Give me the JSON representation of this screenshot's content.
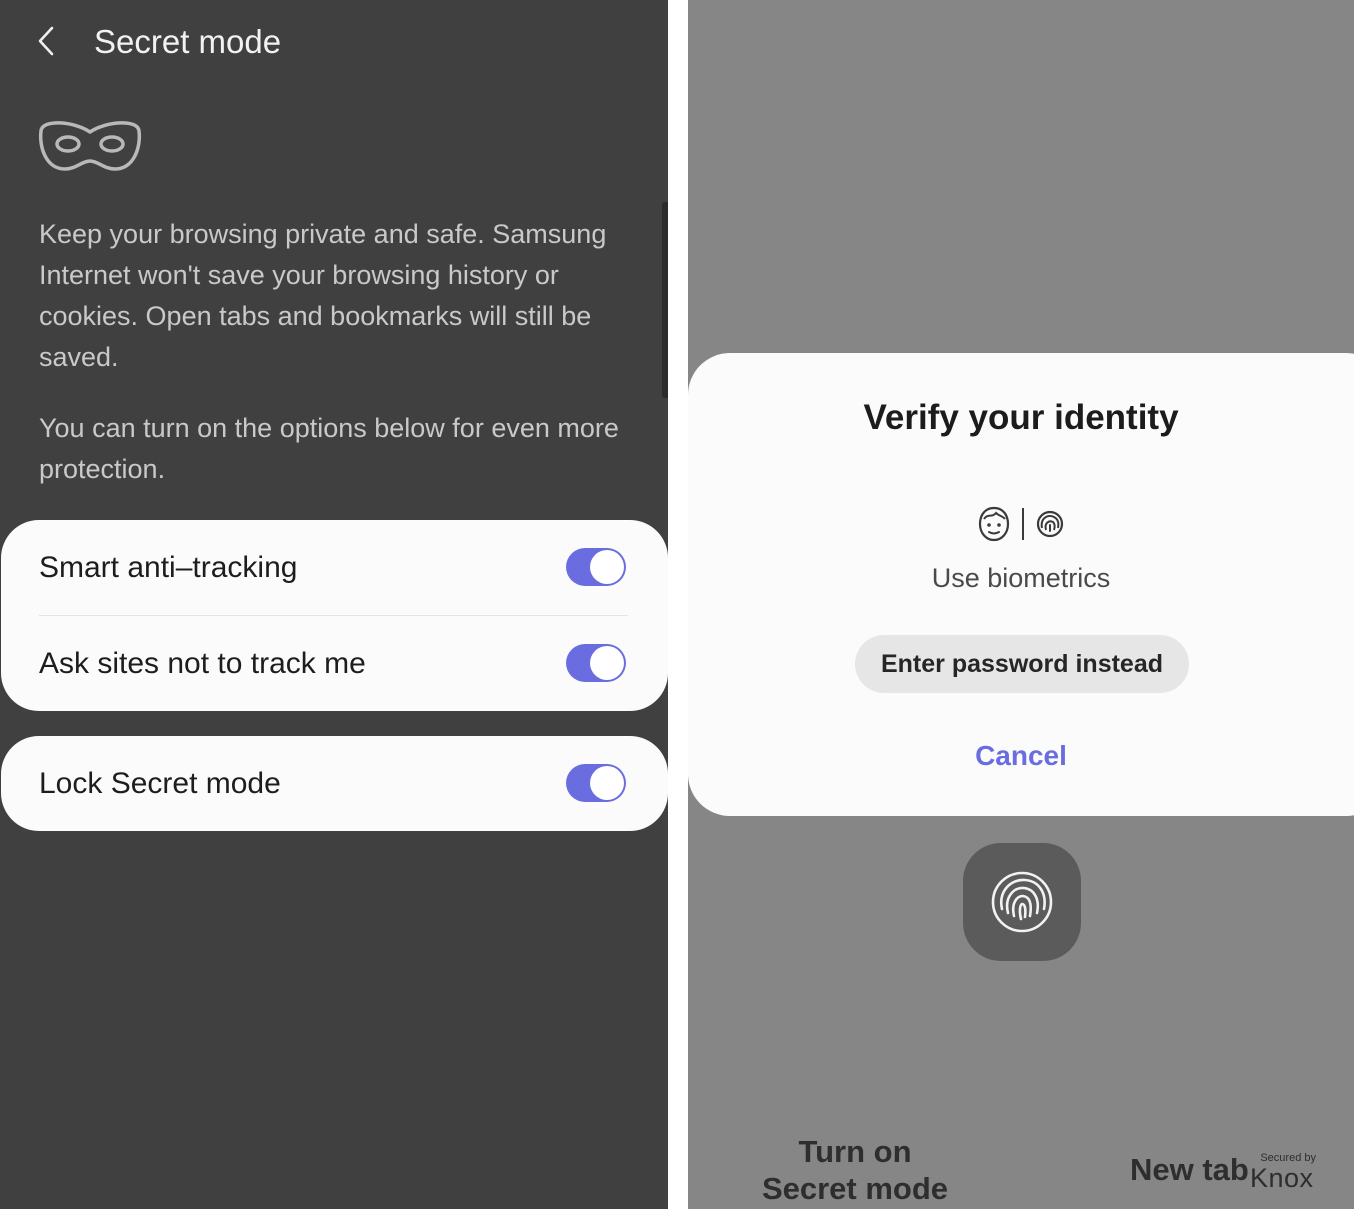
{
  "header": {
    "title": "Secret mode"
  },
  "intro": {
    "description": "Keep your browsing private and safe. Samsung Internet won't save your browsing history or cookies. Open tabs and bookmarks will still be saved.",
    "options_hint": "You can turn on the options below for even more protection."
  },
  "settings": {
    "smart_anti_tracking": {
      "label": "Smart anti–tracking",
      "enabled": true
    },
    "ask_not_track": {
      "label": "Ask sites not to track me",
      "enabled": true
    },
    "lock_secret_mode": {
      "label": "Lock Secret mode",
      "enabled": true
    }
  },
  "dialog": {
    "title": "Verify your identity",
    "biometrics_label": "Use biometrics",
    "password_button": "Enter password instead",
    "cancel_button": "Cancel"
  },
  "bottom_bar": {
    "turn_on_line1": "Turn on",
    "turn_on_line2": "Secret mode",
    "new_tab": "New tab",
    "knox_secured": "Secured by",
    "knox_name": "Knox"
  },
  "icons": {
    "back": "chevron-left-icon",
    "mask": "mask-icon",
    "face": "face-icon",
    "fingerprint": "fingerprint-icon"
  },
  "colors": {
    "accent": "#6a6de0",
    "left_background": "#404040",
    "right_background": "#868686",
    "card_background": "#fbfbfb"
  }
}
